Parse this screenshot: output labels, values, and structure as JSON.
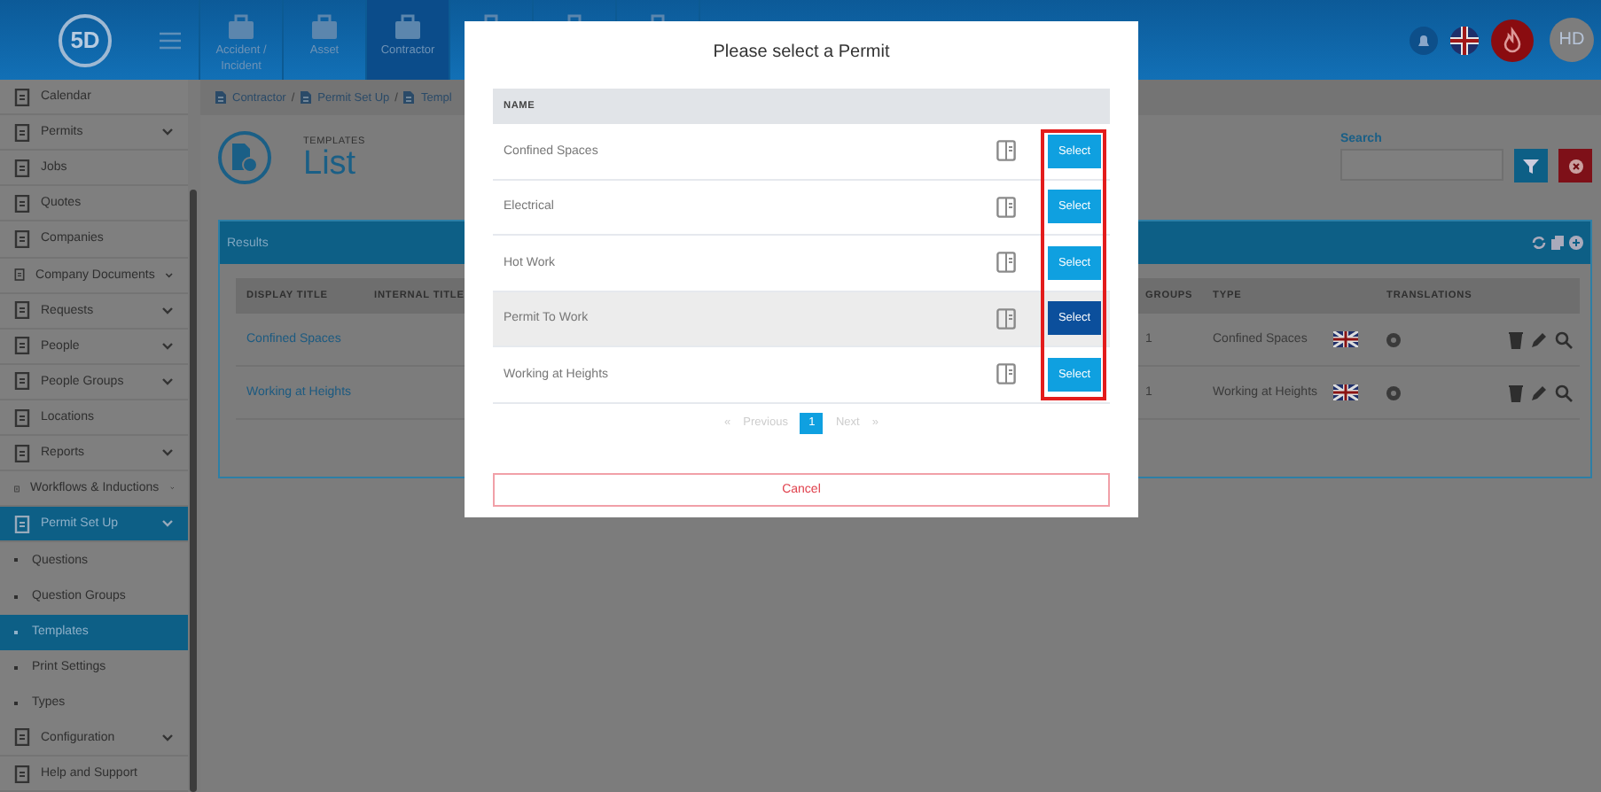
{
  "header": {
    "logo": "5D",
    "nav_tabs": [
      {
        "label": "Accident / Incident",
        "selected": false
      },
      {
        "label": "Asset",
        "selected": false
      },
      {
        "label": "Contractor",
        "selected": true
      },
      {
        "selected": false
      },
      {
        "selected": false
      },
      {
        "selected": false
      }
    ],
    "avatar": "HD"
  },
  "sidebar": {
    "items": [
      {
        "label": "Calendar",
        "has_submenu": false,
        "selected": false
      },
      {
        "label": "Permits",
        "has_submenu": true,
        "selected": false
      },
      {
        "label": "Jobs",
        "has_submenu": false,
        "selected": false
      },
      {
        "label": "Quotes",
        "has_submenu": false,
        "selected": false
      },
      {
        "label": "Companies",
        "has_submenu": false,
        "selected": false
      },
      {
        "label": "Company Documents",
        "has_submenu": true,
        "selected": false
      },
      {
        "label": "Requests",
        "has_submenu": true,
        "selected": false
      },
      {
        "label": "People",
        "has_submenu": true,
        "selected": false
      },
      {
        "label": "People Groups",
        "has_submenu": true,
        "selected": false
      },
      {
        "label": "Locations",
        "has_submenu": false,
        "selected": false
      },
      {
        "label": "Reports",
        "has_submenu": true,
        "selected": false
      },
      {
        "label": "Workflows & Inductions",
        "has_submenu": true,
        "selected": false
      },
      {
        "label": "Permit Set Up",
        "has_submenu": true,
        "selected": true,
        "children": [
          {
            "label": "Questions",
            "selected": false
          },
          {
            "label": "Question Groups",
            "selected": false
          },
          {
            "label": "Templates",
            "selected": true
          },
          {
            "label": "Print Settings",
            "selected": false
          },
          {
            "label": "Types",
            "selected": false
          }
        ]
      },
      {
        "label": "Configuration",
        "has_submenu": true,
        "selected": false
      },
      {
        "label": "Help and Support",
        "has_submenu": false,
        "selected": false
      }
    ]
  },
  "breadcrumb": {
    "separator": "/",
    "items": [
      "Contractor",
      "Permit Set Up",
      "Templ"
    ]
  },
  "page": {
    "subtitle": "TEMPLATES",
    "title": "List",
    "search": {
      "label": "Search"
    }
  },
  "results": {
    "title": "Results",
    "columns": [
      "DISPLAY TITLE",
      "INTERNAL TITLE",
      "GROUPS",
      "TYPE",
      "TRANSLATIONS"
    ],
    "rows": [
      {
        "display_title": "Confined Spaces",
        "groups": "1",
        "type": "Confined Spaces"
      },
      {
        "display_title": "Working at Heights",
        "groups": "1",
        "type": "Working at Heights"
      }
    ]
  },
  "modal": {
    "title": "Please select a Permit",
    "column": "NAME",
    "rows": [
      {
        "name": "Confined Spaces",
        "button": "Select",
        "selected": false
      },
      {
        "name": "Electrical",
        "button": "Select",
        "selected": false
      },
      {
        "name": "Hot Work",
        "button": "Select",
        "selected": false
      },
      {
        "name": "Permit To Work",
        "button": "Select",
        "selected": true
      },
      {
        "name": "Working at Heights",
        "button": "Select",
        "selected": false
      }
    ],
    "pagination": {
      "prev_glyph": "«",
      "previous": "Previous",
      "pages": [
        {
          "label": "1",
          "selected": true
        }
      ],
      "next": "Next",
      "next_glyph": "»"
    },
    "cancel": "Cancel"
  }
}
